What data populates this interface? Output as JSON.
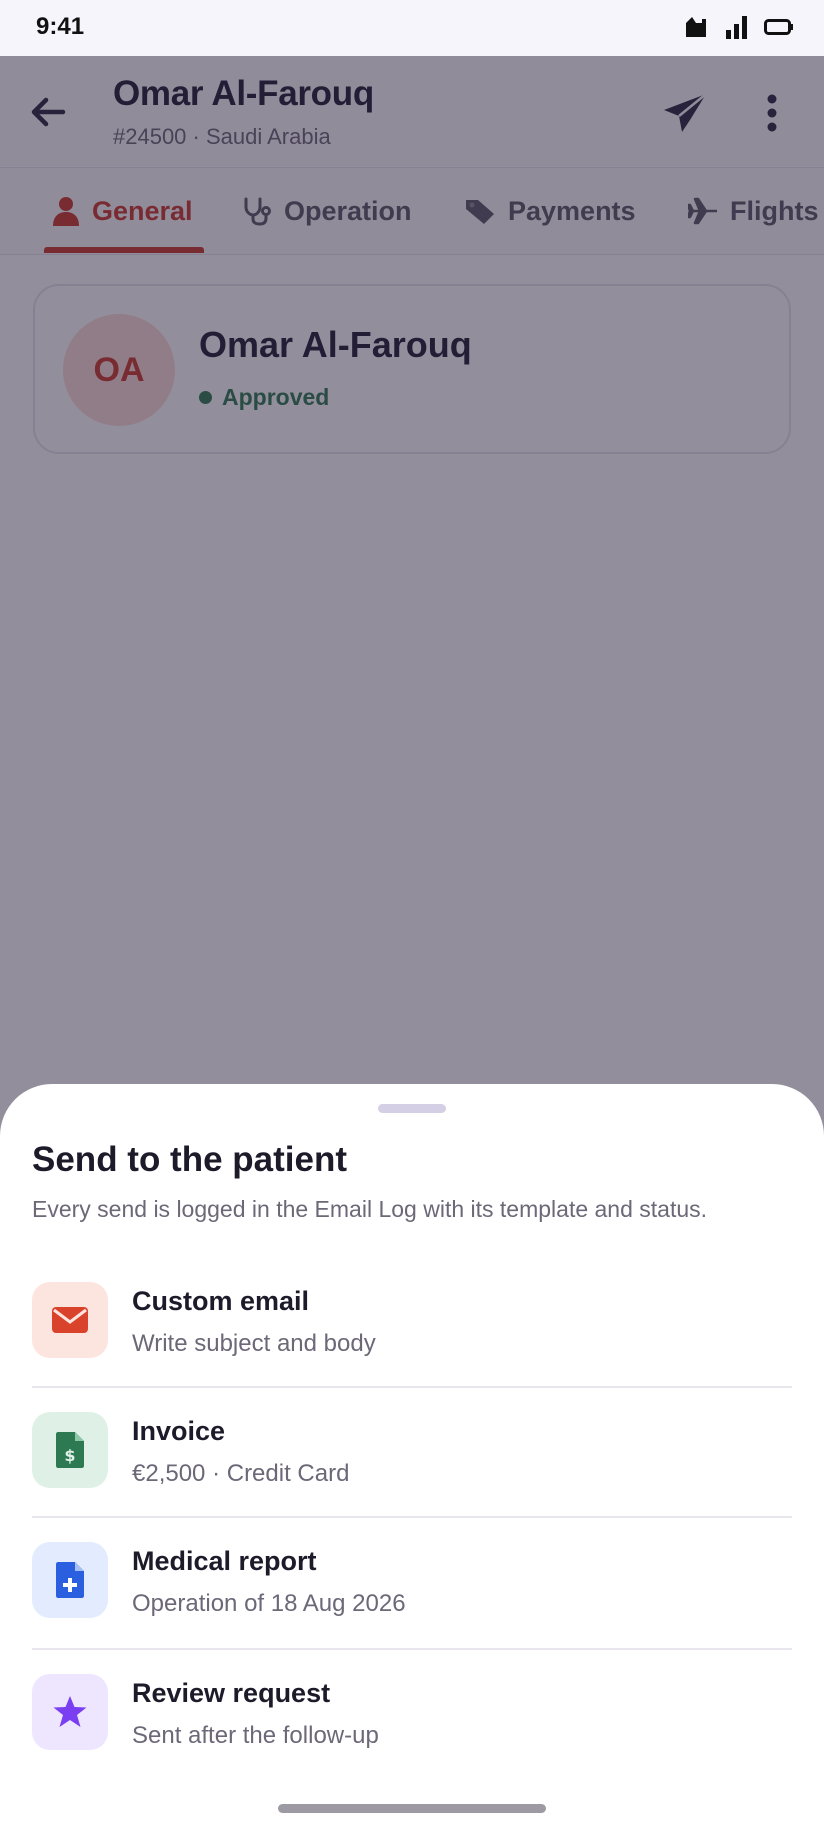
{
  "status_bar": {
    "time": "9:41"
  },
  "header": {
    "title": "Omar Al-Farouq",
    "subtitle": "#24500 · Saudi Arabia"
  },
  "tabs": [
    {
      "label": "General",
      "icon": "person-icon",
      "active": true
    },
    {
      "label": "Operation",
      "icon": "stethoscope-icon",
      "active": false
    },
    {
      "label": "Payments",
      "icon": "tag-icon",
      "active": false
    },
    {
      "label": "Flights",
      "icon": "plane-icon",
      "active": false
    }
  ],
  "profile": {
    "initials": "OA",
    "name": "Omar Al-Farouq",
    "status": "Approved",
    "status_color": "#2d7a52"
  },
  "sheet": {
    "title": "Send to the patient",
    "description": "Every send is logged in the Email Log with its template and status.",
    "options": [
      {
        "title": "Custom email",
        "subtitle": "Write subject and body",
        "icon": "envelope-icon",
        "color": "#d9432c",
        "bg": "#fde5df"
      },
      {
        "title": "Invoice",
        "subtitle": "€2,500 · Credit Card",
        "icon": "invoice-icon",
        "color": "#2d7a52",
        "bg": "#dff1e7"
      },
      {
        "title": "Medical report",
        "subtitle": "Operation of 18 Aug 2026",
        "icon": "medical-report-icon",
        "color": "#2a5fe0",
        "bg": "#e3ebff"
      },
      {
        "title": "Review request",
        "subtitle": "Sent after the follow-up",
        "icon": "star-icon",
        "color": "#7a3ff0",
        "bg": "#eee6ff"
      }
    ]
  },
  "colors": {
    "accent": "#c8392a",
    "scrim": "rgba(40,30,55,0.5)"
  }
}
